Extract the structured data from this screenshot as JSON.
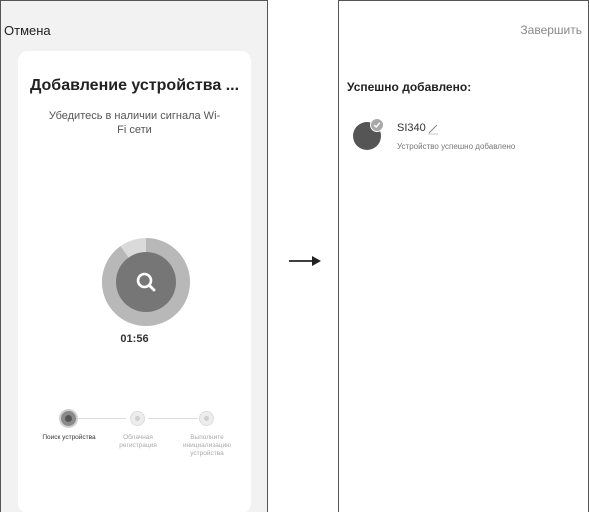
{
  "left_screen": {
    "cancel_label": "Отмена",
    "title": "Добавление устройства ...",
    "subtitle": "Убедитесь в наличии сигнала Wi-Fi сети",
    "search_progress": 0.9,
    "timer": "01:56",
    "steps": [
      {
        "label": "Поиск устройства",
        "state": "active"
      },
      {
        "label": "Облачная регистрация",
        "state": "pending"
      },
      {
        "label": "Выполните инициализацию устройства",
        "state": "pending"
      }
    ],
    "icons": {
      "search": "search-icon"
    }
  },
  "arrow_icon": "right-arrow-icon",
  "right_screen": {
    "finish_label": "Завершить",
    "title": "Успешно добавлено:",
    "device": {
      "name": "SI340",
      "status": "Устройство успешно добавлено"
    },
    "icons": {
      "edit": "pencil-icon",
      "check": "check-icon"
    }
  },
  "colors": {
    "accent_gray": "#767676",
    "ring_light": "#cfcfcf",
    "ring_dark": "#9a9a9a"
  }
}
